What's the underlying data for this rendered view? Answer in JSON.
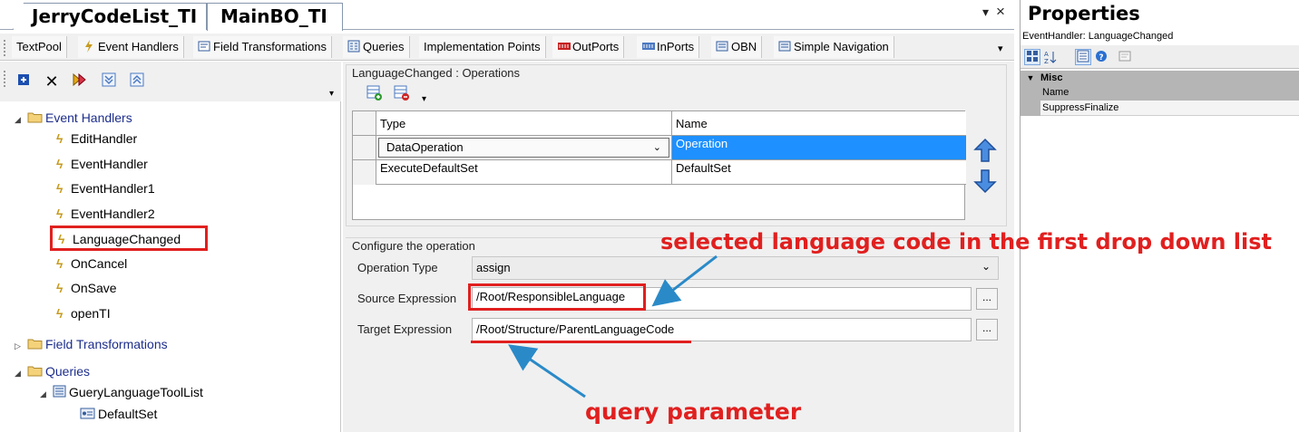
{
  "doc_tabs": {
    "tab1": "JerryCodeList_TI",
    "tab2": "MainBO_TI",
    "dropdown_glyph": "▾",
    "close_glyph": "×"
  },
  "tool_tabs": {
    "textpool": "TextPool",
    "event_handlers": "Event Handlers",
    "field_transformations": "Field Transformations",
    "queries": "Queries",
    "implementation_points": "Implementation Points",
    "outports": "OutPorts",
    "inports": "InPorts",
    "obn": "OBN",
    "simple_navigation": "Simple Navigation"
  },
  "tree": {
    "event_handlers": "Event Handlers",
    "items": [
      "EditHandler",
      "EventHandler",
      "EventHandler1",
      "EventHandler2",
      "LanguageChanged",
      "OnCancel",
      "OnSave",
      "openTI"
    ],
    "field_transformations": "Field Transformations",
    "queries": "Queries",
    "query_item": "GueryLanguageToolList",
    "query_sub": "DefaultSet"
  },
  "operations": {
    "title": "LanguageChanged : Operations",
    "col_type": "Type",
    "col_name": "Name",
    "rows": [
      {
        "type": "DataOperation",
        "name": "Operation"
      },
      {
        "type": "ExecuteDefaultSet",
        "name": "DefaultSet"
      }
    ]
  },
  "configure": {
    "title": "Configure the operation",
    "operation_type_label": "Operation Type",
    "operation_type_value": "assign",
    "source_label": "Source Expression",
    "source_value": "/Root/ResponsibleLanguage",
    "target_label": "Target Expression",
    "target_value": "/Root/Structure/ParentLanguageCode",
    "ellipsis": "..."
  },
  "properties": {
    "title": "Properties",
    "subtitle": "EventHandler: LanguageChanged",
    "category": "Misc",
    "prop_name": "Name",
    "prop_value": "SuppressFinalize"
  },
  "annotations": {
    "top": "selected language code in the first drop down list",
    "bottom": "query parameter"
  },
  "colors": {
    "selection": "#1e90ff",
    "annotation": "#e0201f",
    "arrow": "#2a8ac8"
  }
}
